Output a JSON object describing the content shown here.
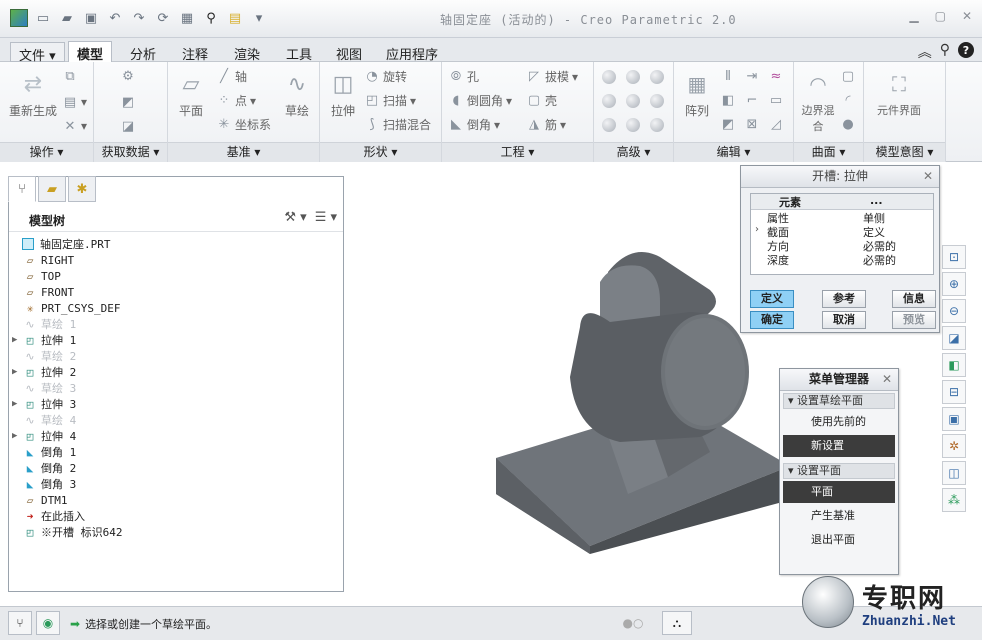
{
  "window": {
    "title": "轴固定座 (活动的) - Creo Parametric 2.0"
  },
  "ribbon_tabs": [
    "文件",
    "模型",
    "分析",
    "注释",
    "渲染",
    "工具",
    "视图",
    "应用程序"
  ],
  "ribbon_groups": {
    "operations": {
      "label": "操作",
      "regenerate": "重新生成"
    },
    "get_data": {
      "label": "获取数据"
    },
    "datum": {
      "label": "基准",
      "plane": "平面",
      "axis": "轴",
      "point": "点",
      "csys": "坐标系",
      "sketch": "草绘"
    },
    "shapes": {
      "label": "形状",
      "extrude": "拉伸",
      "revolve": "旋转",
      "sweep": "扫描",
      "swept_blend": "扫描混合"
    },
    "engineering": {
      "label": "工程",
      "hole": "孔",
      "draft": "拔模",
      "round": "倒圆角",
      "shell": "壳",
      "chamfer": "倒角",
      "rib": "筋"
    },
    "advanced": {
      "label": "高级"
    },
    "editing": {
      "label": "编辑",
      "pattern": "阵列"
    },
    "surfaces": {
      "label": "曲面",
      "boundary_blend": "边界混合"
    },
    "model_intent": {
      "label": "模型意图",
      "component_interface": "元件界面"
    }
  },
  "model_tree": {
    "title": "模型树",
    "items": [
      {
        "label": "轴固定座.PRT",
        "icon": "part-icon",
        "dim": false,
        "expandable": false
      },
      {
        "label": "RIGHT",
        "icon": "datum-plane-icon",
        "dim": false,
        "expandable": false
      },
      {
        "label": "TOP",
        "icon": "datum-plane-icon",
        "dim": false,
        "expandable": false
      },
      {
        "label": "FRONT",
        "icon": "datum-plane-icon",
        "dim": false,
        "expandable": false
      },
      {
        "label": "PRT_CSYS_DEF",
        "icon": "csys-icon",
        "dim": false,
        "expandable": false
      },
      {
        "label": "草绘 1",
        "icon": "sketch-icon",
        "dim": true,
        "expandable": false
      },
      {
        "label": "拉伸 1",
        "icon": "extrude-icon",
        "dim": false,
        "expandable": true
      },
      {
        "label": "草绘 2",
        "icon": "sketch-icon",
        "dim": true,
        "expandable": false
      },
      {
        "label": "拉伸 2",
        "icon": "extrude-icon",
        "dim": false,
        "expandable": true
      },
      {
        "label": "草绘 3",
        "icon": "sketch-icon",
        "dim": true,
        "expandable": false
      },
      {
        "label": "拉伸 3",
        "icon": "extrude-icon",
        "dim": false,
        "expandable": true
      },
      {
        "label": "草绘 4",
        "icon": "sketch-icon",
        "dim": true,
        "expandable": false
      },
      {
        "label": "拉伸 4",
        "icon": "extrude-icon",
        "dim": false,
        "expandable": true
      },
      {
        "label": "倒角 1",
        "icon": "round-icon",
        "dim": false,
        "expandable": false
      },
      {
        "label": "倒角 2",
        "icon": "round-icon",
        "dim": false,
        "expandable": false
      },
      {
        "label": "倒角 3",
        "icon": "round-icon",
        "dim": false,
        "expandable": false
      },
      {
        "label": "DTM1",
        "icon": "datum-plane-icon",
        "dim": false,
        "expandable": false
      },
      {
        "label": "在此插入",
        "icon": "insert-here-icon",
        "dim": false,
        "expandable": false
      },
      {
        "label": "※开槽 标识642",
        "icon": "extrude-icon",
        "dim": false,
        "expandable": false
      }
    ]
  },
  "slot_dialog": {
    "title": "开槽: 拉伸",
    "col_element": "元素",
    "col_info": "...",
    "rows": [
      {
        "name": "属性",
        "value": "单侧",
        "current": false
      },
      {
        "name": "截面",
        "value": "定义",
        "current": true
      },
      {
        "name": "方向",
        "value": "必需的",
        "current": false
      },
      {
        "name": "深度",
        "value": "必需的",
        "current": false
      }
    ],
    "buttons": {
      "define": "定义",
      "refs": "参考",
      "info": "信息",
      "ok": "确定",
      "cancel": "取消",
      "preview": "预览"
    }
  },
  "menu_manager": {
    "title": "菜单管理器",
    "section1": "设置草绘平面",
    "use_previous": "使用先前的",
    "new_setting": "新设置",
    "section2": "设置平面",
    "plane": "平面",
    "make_datum": "产生基准",
    "exit_plane": "退出平面"
  },
  "status": {
    "message": "选择或创建一个草绘平面。"
  },
  "watermark": {
    "zh": "专职网",
    "en": "Zhuanzhi.Net"
  }
}
